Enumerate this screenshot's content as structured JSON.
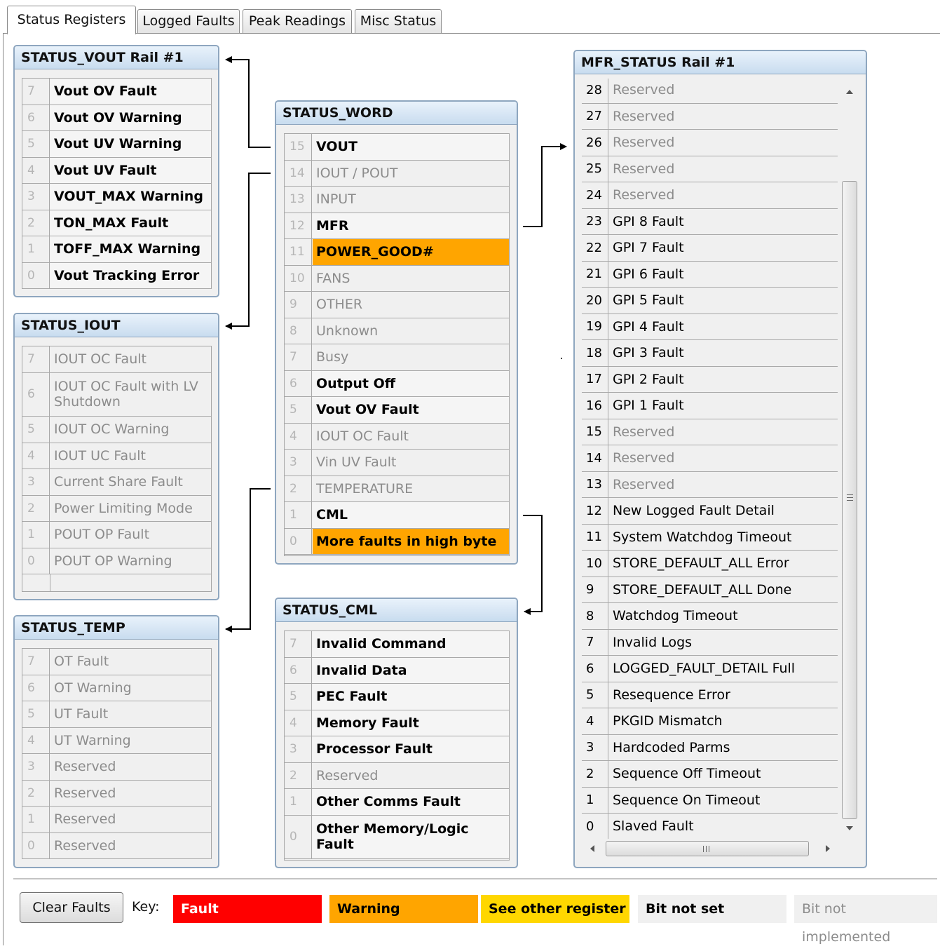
{
  "tabs": [
    "Status Registers",
    "Logged Faults",
    "Peak Readings",
    "Misc Status"
  ],
  "status_vout": {
    "title": "STATUS_VOUT Rail #1",
    "rows": [
      {
        "bit": "7",
        "label": "Vout OV Fault",
        "state": "set"
      },
      {
        "bit": "6",
        "label": "Vout OV Warning",
        "state": "set"
      },
      {
        "bit": "5",
        "label": "Vout UV Warning",
        "state": "set"
      },
      {
        "bit": "4",
        "label": "Vout UV Fault",
        "state": "set"
      },
      {
        "bit": "3",
        "label": "VOUT_MAX Warning",
        "state": "set"
      },
      {
        "bit": "2",
        "label": "TON_MAX Fault",
        "state": "set"
      },
      {
        "bit": "1",
        "label": "TOFF_MAX Warning",
        "state": "set"
      },
      {
        "bit": "0",
        "label": "Vout Tracking Error",
        "state": "set"
      }
    ]
  },
  "status_iout": {
    "title": "STATUS_IOUT",
    "rows": [
      {
        "bit": "7",
        "label": "IOUT OC Fault",
        "state": "ni"
      },
      {
        "bit": "6",
        "label": "IOUT OC Fault with LV Shutdown",
        "state": "ni"
      },
      {
        "bit": "5",
        "label": "IOUT OC Warning",
        "state": "ni"
      },
      {
        "bit": "4",
        "label": "IOUT UC Fault",
        "state": "ni"
      },
      {
        "bit": "3",
        "label": "Current Share Fault",
        "state": "ni"
      },
      {
        "bit": "2",
        "label": "Power Limiting Mode",
        "state": "ni"
      },
      {
        "bit": "1",
        "label": "POUT OP Fault",
        "state": "ni"
      },
      {
        "bit": "0",
        "label": "POUT OP Warning",
        "state": "ni"
      }
    ]
  },
  "status_temp": {
    "title": "STATUS_TEMP",
    "rows": [
      {
        "bit": "7",
        "label": "OT Fault",
        "state": "ni"
      },
      {
        "bit": "6",
        "label": "OT Warning",
        "state": "ni"
      },
      {
        "bit": "5",
        "label": "UT Fault",
        "state": "ni"
      },
      {
        "bit": "4",
        "label": "UT Warning",
        "state": "ni"
      },
      {
        "bit": "3",
        "label": "Reserved",
        "state": "ni"
      },
      {
        "bit": "2",
        "label": "Reserved",
        "state": "ni"
      },
      {
        "bit": "1",
        "label": "Reserved",
        "state": "ni"
      },
      {
        "bit": "0",
        "label": "Reserved",
        "state": "ni"
      }
    ]
  },
  "status_word": {
    "title": "STATUS_WORD",
    "rows": [
      {
        "bit": "15",
        "label": "VOUT",
        "state": "set"
      },
      {
        "bit": "14",
        "label": "IOUT / POUT",
        "state": "ni"
      },
      {
        "bit": "13",
        "label": "INPUT",
        "state": "ni"
      },
      {
        "bit": "12",
        "label": "MFR",
        "state": "set"
      },
      {
        "bit": "11",
        "label": "POWER_GOOD#",
        "state": "warn"
      },
      {
        "bit": "10",
        "label": "FANS",
        "state": "ni"
      },
      {
        "bit": "9",
        "label": "OTHER",
        "state": "ni"
      },
      {
        "bit": "8",
        "label": "Unknown",
        "state": "ni"
      },
      {
        "bit": "7",
        "label": "Busy",
        "state": "ni"
      },
      {
        "bit": "6",
        "label": "Output Off",
        "state": "set"
      },
      {
        "bit": "5",
        "label": "Vout OV Fault",
        "state": "set"
      },
      {
        "bit": "4",
        "label": "IOUT OC Fault",
        "state": "ni"
      },
      {
        "bit": "3",
        "label": "Vin UV Fault",
        "state": "ni"
      },
      {
        "bit": "2",
        "label": "TEMPERATURE",
        "state": "ni"
      },
      {
        "bit": "1",
        "label": "CML",
        "state": "set"
      },
      {
        "bit": "0",
        "label": "More faults in high byte",
        "state": "warn"
      }
    ]
  },
  "status_cml": {
    "title": "STATUS_CML",
    "rows": [
      {
        "bit": "7",
        "label": "Invalid Command",
        "state": "set"
      },
      {
        "bit": "6",
        "label": "Invalid Data",
        "state": "set"
      },
      {
        "bit": "5",
        "label": "PEC Fault",
        "state": "set"
      },
      {
        "bit": "4",
        "label": "Memory Fault",
        "state": "set"
      },
      {
        "bit": "3",
        "label": "Processor Fault",
        "state": "set"
      },
      {
        "bit": "2",
        "label": "Reserved",
        "state": "ni"
      },
      {
        "bit": "1",
        "label": "Other Comms Fault",
        "state": "set"
      },
      {
        "bit": "0",
        "label": "Other Memory/Logic Fault",
        "state": "set"
      }
    ]
  },
  "mfr_status": {
    "title": "MFR_STATUS Rail #1",
    "rows": [
      {
        "bit": "28",
        "label": "Reserved",
        "state": "ni"
      },
      {
        "bit": "27",
        "label": "Reserved",
        "state": "ni"
      },
      {
        "bit": "26",
        "label": "Reserved",
        "state": "ni"
      },
      {
        "bit": "25",
        "label": "Reserved",
        "state": "ni"
      },
      {
        "bit": "24",
        "label": "Reserved",
        "state": "ni"
      },
      {
        "bit": "23",
        "label": "GPI 8 Fault",
        "state": "set"
      },
      {
        "bit": "22",
        "label": "GPI 7 Fault",
        "state": "set"
      },
      {
        "bit": "21",
        "label": "GPI 6 Fault",
        "state": "set"
      },
      {
        "bit": "20",
        "label": "GPI 5 Fault",
        "state": "set"
      },
      {
        "bit": "19",
        "label": "GPI 4 Fault",
        "state": "set"
      },
      {
        "bit": "18",
        "label": "GPI 3 Fault",
        "state": "set"
      },
      {
        "bit": "17",
        "label": "GPI 2 Fault",
        "state": "set"
      },
      {
        "bit": "16",
        "label": "GPI 1 Fault",
        "state": "set"
      },
      {
        "bit": "15",
        "label": "Reserved",
        "state": "ni"
      },
      {
        "bit": "14",
        "label": "Reserved",
        "state": "ni"
      },
      {
        "bit": "13",
        "label": "Reserved",
        "state": "ni"
      },
      {
        "bit": "12",
        "label": "New Logged Fault Detail",
        "state": "set"
      },
      {
        "bit": "11",
        "label": "System Watchdog Timeout",
        "state": "set"
      },
      {
        "bit": "10",
        "label": "STORE_DEFAULT_ALL Error",
        "state": "set"
      },
      {
        "bit": "9",
        "label": "STORE_DEFAULT_ALL Done",
        "state": "set"
      },
      {
        "bit": "8",
        "label": "Watchdog Timeout",
        "state": "set"
      },
      {
        "bit": "7",
        "label": "Invalid Logs",
        "state": "set"
      },
      {
        "bit": "6",
        "label": "LOGGED_FAULT_DETAIL Full",
        "state": "set"
      },
      {
        "bit": "5",
        "label": "Resequence Error",
        "state": "set"
      },
      {
        "bit": "4",
        "label": "PKGID Mismatch",
        "state": "set"
      },
      {
        "bit": "3",
        "label": "Hardcoded Parms",
        "state": "set"
      },
      {
        "bit": "2",
        "label": "Sequence Off Timeout",
        "state": "set"
      },
      {
        "bit": "1",
        "label": "Sequence On Timeout",
        "state": "set"
      },
      {
        "bit": "0",
        "label": "Slaved Fault",
        "state": "set"
      }
    ]
  },
  "footer": {
    "clear_label": "Clear Faults",
    "key_label": "Key:",
    "keys": [
      {
        "label": "Fault",
        "bg": "#ff0000",
        "fg": "#ffffff"
      },
      {
        "label": "Warning",
        "bg": "#ffa500",
        "fg": "#000000"
      },
      {
        "label": "See other register",
        "bg": "#ffd700",
        "fg": "#000000"
      },
      {
        "label": "Bit not set",
        "bg": "#f0f0f0",
        "fg": "#000000"
      },
      {
        "label": "Bit not implemented",
        "bg": "#f0f0f0",
        "fg": "#8c8c8c"
      }
    ]
  },
  "colors": {
    "warning": "#ffa500",
    "panel_border": "#8ea6bf",
    "header_bg": "#c8dcef"
  }
}
